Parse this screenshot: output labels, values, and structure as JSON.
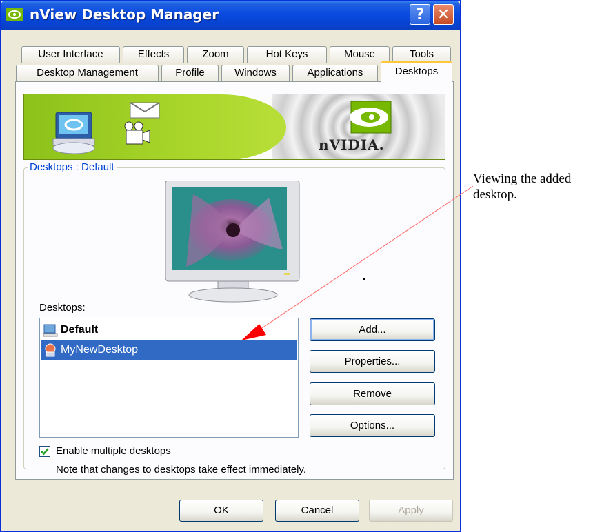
{
  "window": {
    "title": "nView Desktop Manager",
    "help_glyph": "?",
    "close_glyph": "✕"
  },
  "tabs": {
    "row1": [
      "User Interface",
      "Effects",
      "Zoom",
      "Hot Keys",
      "Mouse",
      "Tools"
    ],
    "row2": [
      "Desktop Management",
      "Profile",
      "Windows",
      "Applications",
      "Desktops"
    ],
    "active": "Desktops"
  },
  "banner": {
    "brand_text": "nVIDIA."
  },
  "group": {
    "title": "Desktops : Default"
  },
  "desktops_list": {
    "label": "Desktops:",
    "items": [
      {
        "label": "Default",
        "bold": true,
        "selected": false,
        "icon": "desktop-default-icon"
      },
      {
        "label": "MyNewDesktop",
        "bold": false,
        "selected": true,
        "icon": "desktop-custom-icon"
      }
    ]
  },
  "buttons": {
    "add": "Add...",
    "properties": "Properties...",
    "remove": "Remove",
    "options": "Options..."
  },
  "checkbox": {
    "label": "Enable multiple desktops",
    "checked": true
  },
  "note": "Note that changes to desktops take effect immediately.",
  "dialog_buttons": {
    "ok": "OK",
    "cancel": "Cancel",
    "apply": "Apply"
  },
  "annotation": {
    "line1": "Viewing the added",
    "line2": "desktop."
  },
  "colors": {
    "titlebar": "#0a4be0",
    "selection": "#316ac5",
    "group_title": "#0046d5",
    "arrow": "#ff0000"
  }
}
